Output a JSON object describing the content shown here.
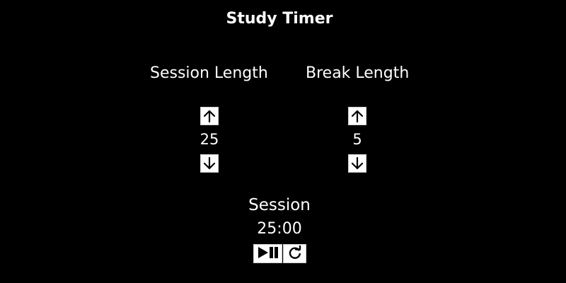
{
  "app": {
    "title": "Study Timer"
  },
  "session": {
    "label": "Session Length",
    "length": "25",
    "increment_icon": "arrow-up-icon",
    "decrement_icon": "arrow-down-icon"
  },
  "break": {
    "label": "Break Length",
    "length": "5",
    "increment_icon": "arrow-up-icon",
    "decrement_icon": "arrow-down-icon"
  },
  "timer": {
    "label": "Session",
    "time_left": "25:00",
    "start_stop_icon": "play-pause-icon",
    "reset_icon": "refresh-icon"
  },
  "colors": {
    "background": "#000000",
    "text": "#ffffff",
    "button_background": "#ffffff",
    "icon": "#000000"
  }
}
